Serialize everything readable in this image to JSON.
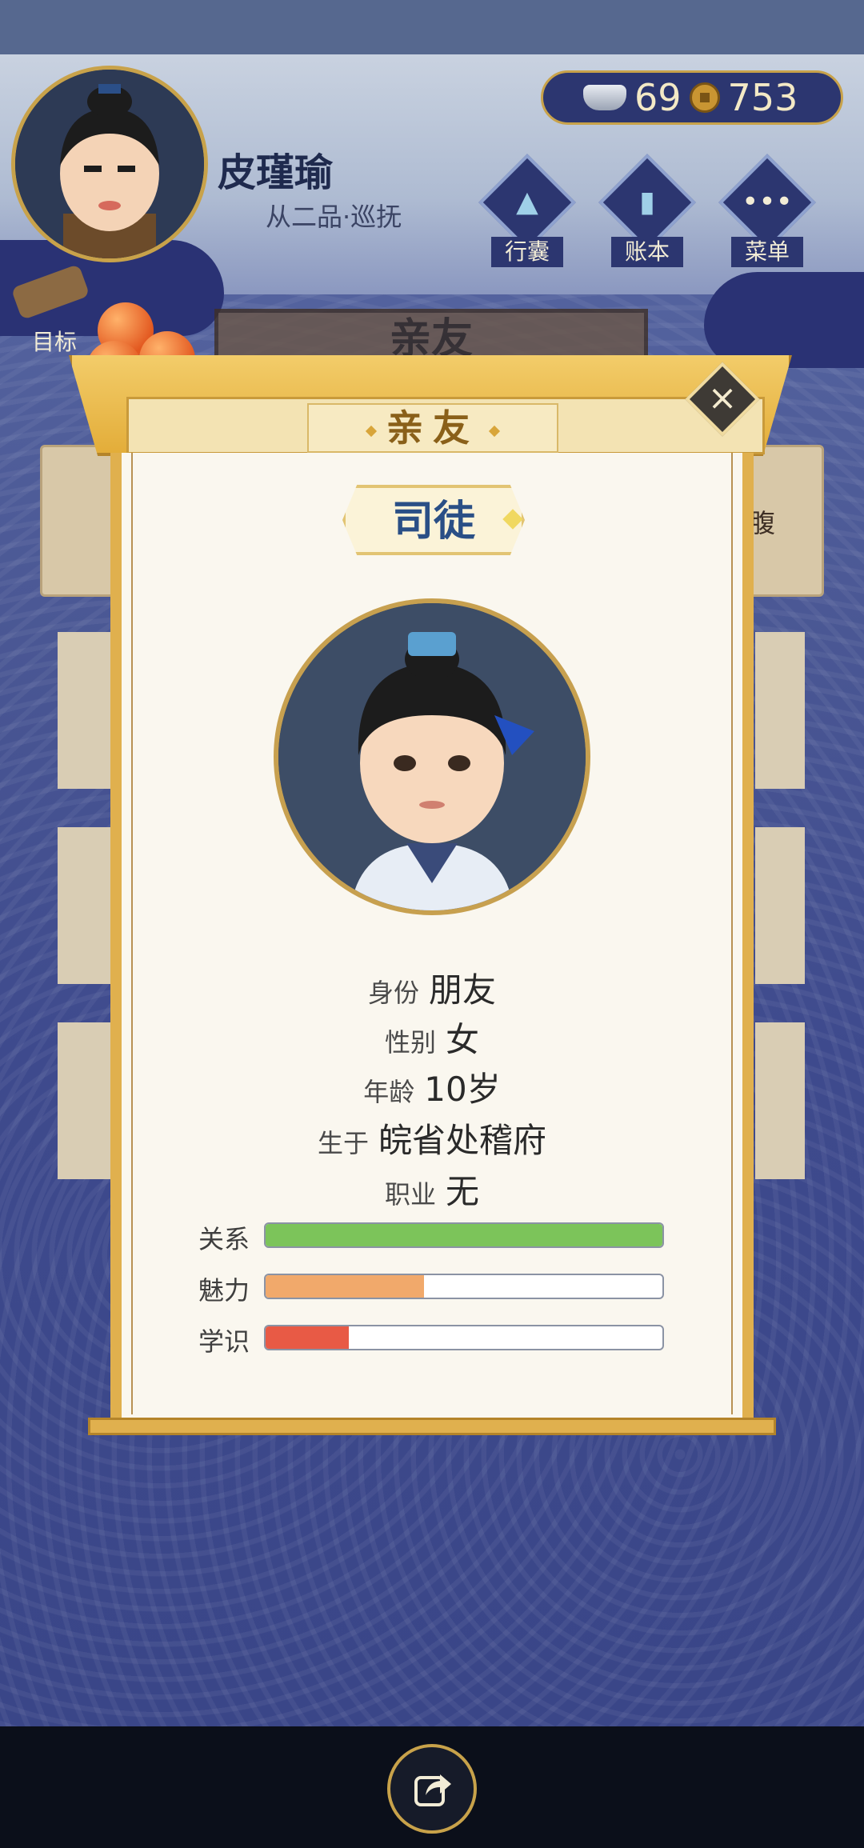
{
  "player": {
    "name": "皮瑾瑜",
    "rank": "从二品·巡抚"
  },
  "currency": {
    "silver": "69",
    "copper": "753"
  },
  "menu": [
    {
      "label": "行囊",
      "icon": "bag-icon"
    },
    {
      "label": "账本",
      "icon": "ledger-icon"
    },
    {
      "label": "菜单",
      "icon": "more-icon"
    }
  ],
  "goal": {
    "label": "目标"
  },
  "background": {
    "title": "亲友",
    "partial_text": "腹"
  },
  "modal": {
    "title": "亲友",
    "person_name": "司徒",
    "info": [
      {
        "key": "身份",
        "value": "朋友"
      },
      {
        "key": "性别",
        "value": "女"
      },
      {
        "key": "年龄",
        "value": "10岁"
      },
      {
        "key": "生于",
        "value": "皖省处稽府"
      },
      {
        "key": "职业",
        "value": "无"
      }
    ],
    "stats": [
      {
        "label": "关系",
        "level": 1.0,
        "color": "#7cc45a"
      },
      {
        "label": "魅力",
        "level": 0.4,
        "color": "#f1a96b"
      },
      {
        "label": "学识",
        "level": 0.21,
        "color": "#e85a45"
      }
    ]
  },
  "colors": {
    "accent_gold": "#e0b04e",
    "name_blue": "#2a4f86",
    "frame_navy": "#2c3670"
  }
}
